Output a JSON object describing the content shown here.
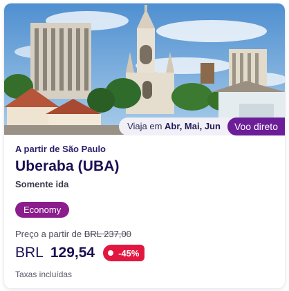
{
  "photo": {
    "icon": "city-cathedral-photo"
  },
  "badges": {
    "travel_prefix": "Viaja em",
    "travel_months": "Abr, Mai, Jun",
    "direct": "Voo direto"
  },
  "offer": {
    "origin": "A partir de São Paulo",
    "destination": "Uberaba (UBA)",
    "trip_type": "Somente ida",
    "cabin": "Economy",
    "from_price_label": "Preço a partir de",
    "old_price": "BRL 237,00",
    "currency": "BRL",
    "price": "129,54",
    "discount": "-45%",
    "taxes": "Taxas incluídas"
  },
  "colors": {
    "brand_purple": "#6c1d98",
    "cabin_magenta": "#8b1d8d",
    "discount_red": "#e2173f",
    "text_navy": "#1b0f52"
  }
}
